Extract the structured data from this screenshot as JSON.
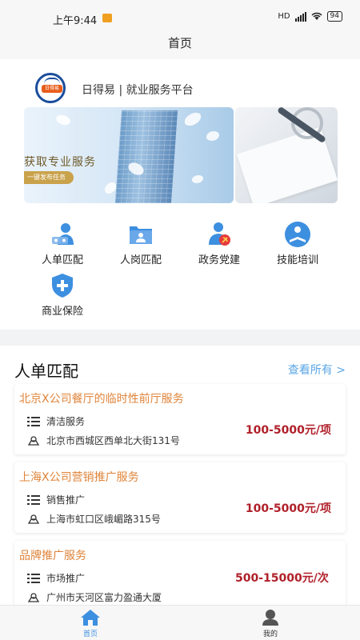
{
  "status_bar": {
    "time": "上午9:44",
    "network": "HD",
    "battery": "94"
  },
  "page_title": "首页",
  "brand": {
    "logo_text": "日得易",
    "title": "日得易 | 就业服务平台"
  },
  "banner": {
    "headline": "获取专业服务",
    "sub": "一键发布任务"
  },
  "nav": [
    {
      "label": "人单匹配",
      "icon": "people-match-icon"
    },
    {
      "label": "人岗匹配",
      "icon": "job-match-icon"
    },
    {
      "label": "政务党建",
      "icon": "party-building-icon"
    },
    {
      "label": "技能培训",
      "icon": "training-icon"
    },
    {
      "label": "商业保险",
      "icon": "insurance-icon"
    }
  ],
  "section": {
    "title": "人单匹配",
    "more": "查看所有 >"
  },
  "jobs": [
    {
      "title": "北京X公司餐厅的临时性前厅服务",
      "category": "清洁服务",
      "address": "北京市西城区西单北大街131号",
      "price": "100-5000元/项"
    },
    {
      "title": "上海X公司营销推广服务",
      "category": "销售推广",
      "address": "上海市虹口区峨嵋路315号",
      "price": "100-5000元/项"
    },
    {
      "title": "品牌推广服务",
      "category": "市场推广",
      "address": "广州市天河区富力盈通大厦",
      "price": "500-15000元/次"
    }
  ],
  "tabs": [
    {
      "label": "首页",
      "active": true
    },
    {
      "label": "我的",
      "active": false
    }
  ],
  "colors": {
    "accent": "#3d8fe0",
    "job_title": "#e0843a",
    "price": "#b0202a",
    "link": "#5aa6e6"
  }
}
